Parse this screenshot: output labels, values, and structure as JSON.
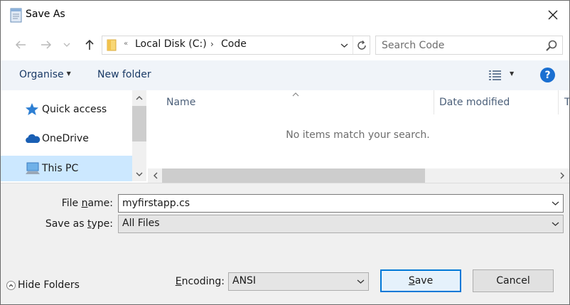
{
  "window": {
    "title": "Save As",
    "close_glyph": "✕"
  },
  "nav": {
    "back_glyph": "←",
    "forward_glyph": "→",
    "recent_glyph": "⌄",
    "up_glyph": "↑"
  },
  "address": {
    "overflow_glyph": "«",
    "crumbs": [
      "Local Disk (C:)",
      "Code"
    ],
    "separator_glyph": "›",
    "dropdown_glyph": "⌄",
    "refresh_glyph": "↻"
  },
  "search": {
    "placeholder": "Search Code"
  },
  "toolbar": {
    "organise_label": "Organise",
    "new_folder_label": "New folder",
    "caret_glyph": "▼",
    "help_glyph": "?"
  },
  "sidebar": {
    "items": [
      {
        "label": "Quick access",
        "icon": "star-icon"
      },
      {
        "label": "OneDrive",
        "icon": "cloud-icon"
      },
      {
        "label": "This PC",
        "icon": "computer-icon",
        "selected": true
      }
    ]
  },
  "filelist": {
    "columns": [
      "Name",
      "Date modified",
      "T"
    ],
    "empty_message": "No items match your search."
  },
  "form": {
    "filename_label_pre": "File ",
    "filename_label_u": "n",
    "filename_label_post": "ame:",
    "filename_value": "myfirstapp.cs",
    "type_label_pre": "Save as ",
    "type_label_u": "t",
    "type_label_post": "ype:",
    "type_value": "All Files",
    "encoding_label_pre": "",
    "encoding_label_u": "E",
    "encoding_label_post": "ncoding:",
    "encoding_value": "ANSI",
    "hide_folders_label": "Hide Folders",
    "save_label_u": "S",
    "save_label_post": "ave",
    "cancel_label": "Cancel"
  },
  "colors": {
    "accent": "#0078d7",
    "selection": "#cce8ff",
    "command_bar": "#f0f4f9",
    "help": "#1a6fd1"
  }
}
